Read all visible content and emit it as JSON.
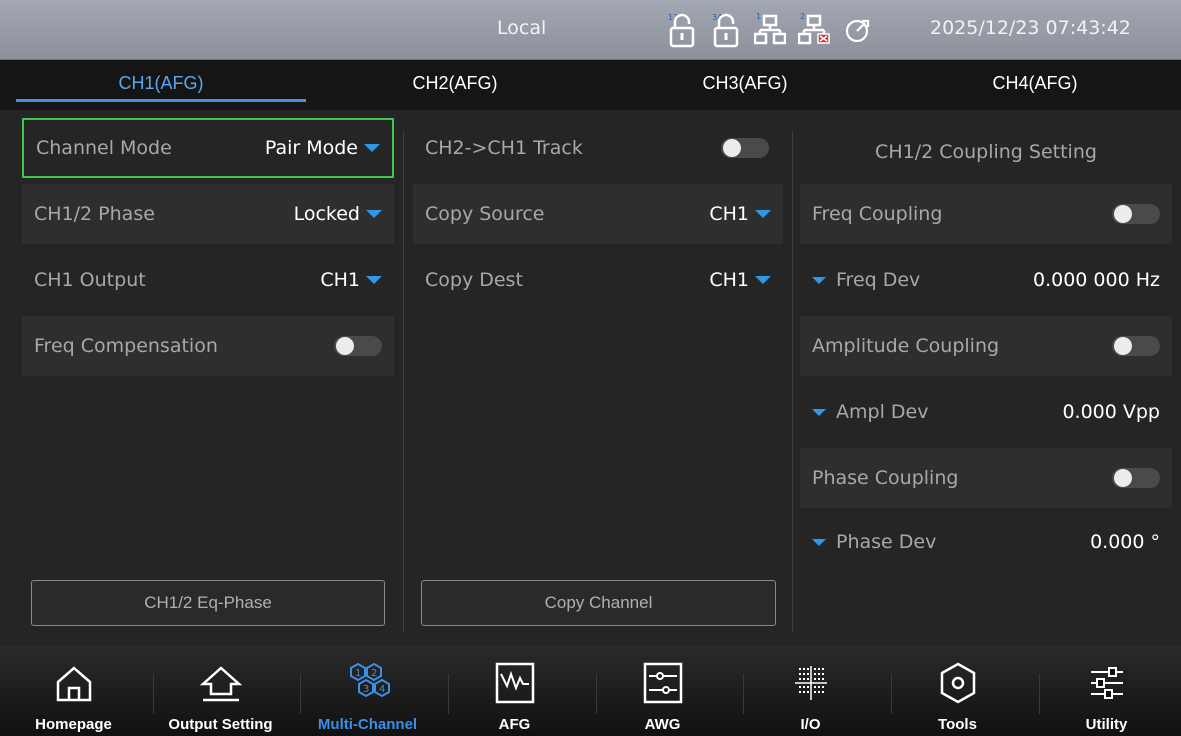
{
  "status": {
    "title": "Local",
    "datetime": "2025/12/23 07:43:42",
    "icons": [
      "lock-12-icon",
      "lock-34-icon",
      "network-1-icon",
      "network-2-disconnected-icon",
      "clock-icon"
    ],
    "icon_labels": [
      "12",
      "34",
      "1",
      "2"
    ]
  },
  "tabs": [
    "CH1(AFG)",
    "CH2(AFG)",
    "CH3(AFG)",
    "CH4(AFG)"
  ],
  "left": {
    "channel_mode_label": "Channel Mode",
    "channel_mode_value": "Pair Mode",
    "phase_label": "CH1/2 Phase",
    "phase_value": "Locked",
    "output_label": "CH1 Output",
    "output_value": "CH1",
    "freq_comp_label": "Freq Compensation",
    "eq_phase_button": "CH1/2 Eq-Phase"
  },
  "middle": {
    "track_label": "CH2->CH1 Track",
    "copy_source_label": "Copy Source",
    "copy_source_value": "CH1",
    "copy_dest_label": "Copy Dest",
    "copy_dest_value": "CH1",
    "copy_button": "Copy Channel"
  },
  "right": {
    "heading": "CH1/2 Coupling Setting",
    "freq_coupling_label": "Freq Coupling",
    "freq_dev_label": "Freq Dev",
    "freq_dev_value": "0.000 000 Hz",
    "ampl_coupling_label": "Amplitude Coupling",
    "ampl_dev_label": "Ampl Dev",
    "ampl_dev_value": "0.000 Vpp",
    "phase_coupling_label": "Phase Coupling",
    "phase_dev_label": "Phase Dev",
    "phase_dev_value": "0.000 °"
  },
  "toggles": {
    "track": false,
    "freq_compensation": false,
    "freq_coupling": false,
    "amplitude_coupling": false,
    "phase_coupling": false
  },
  "nav": [
    "Homepage",
    "Output Setting",
    "Multi-Channel",
    "AFG",
    "AWG",
    "I/O",
    "Tools",
    "Utility"
  ],
  "nav_icons": [
    "home-icon",
    "output-setting-icon",
    "multi-channel-icon",
    "afg-waveform-icon",
    "awg-icon",
    "io-grid-icon",
    "tools-hexagon-icon",
    "utility-sliders-icon"
  ],
  "nav_multichannel_digits": [
    "1",
    "2",
    "3",
    "4"
  ],
  "colors": {
    "accent": "#3a8fe6",
    "active_tab": "#5da6ee",
    "focus_border": "#3fc64a",
    "dropdown_caret": "#2f98e8"
  }
}
